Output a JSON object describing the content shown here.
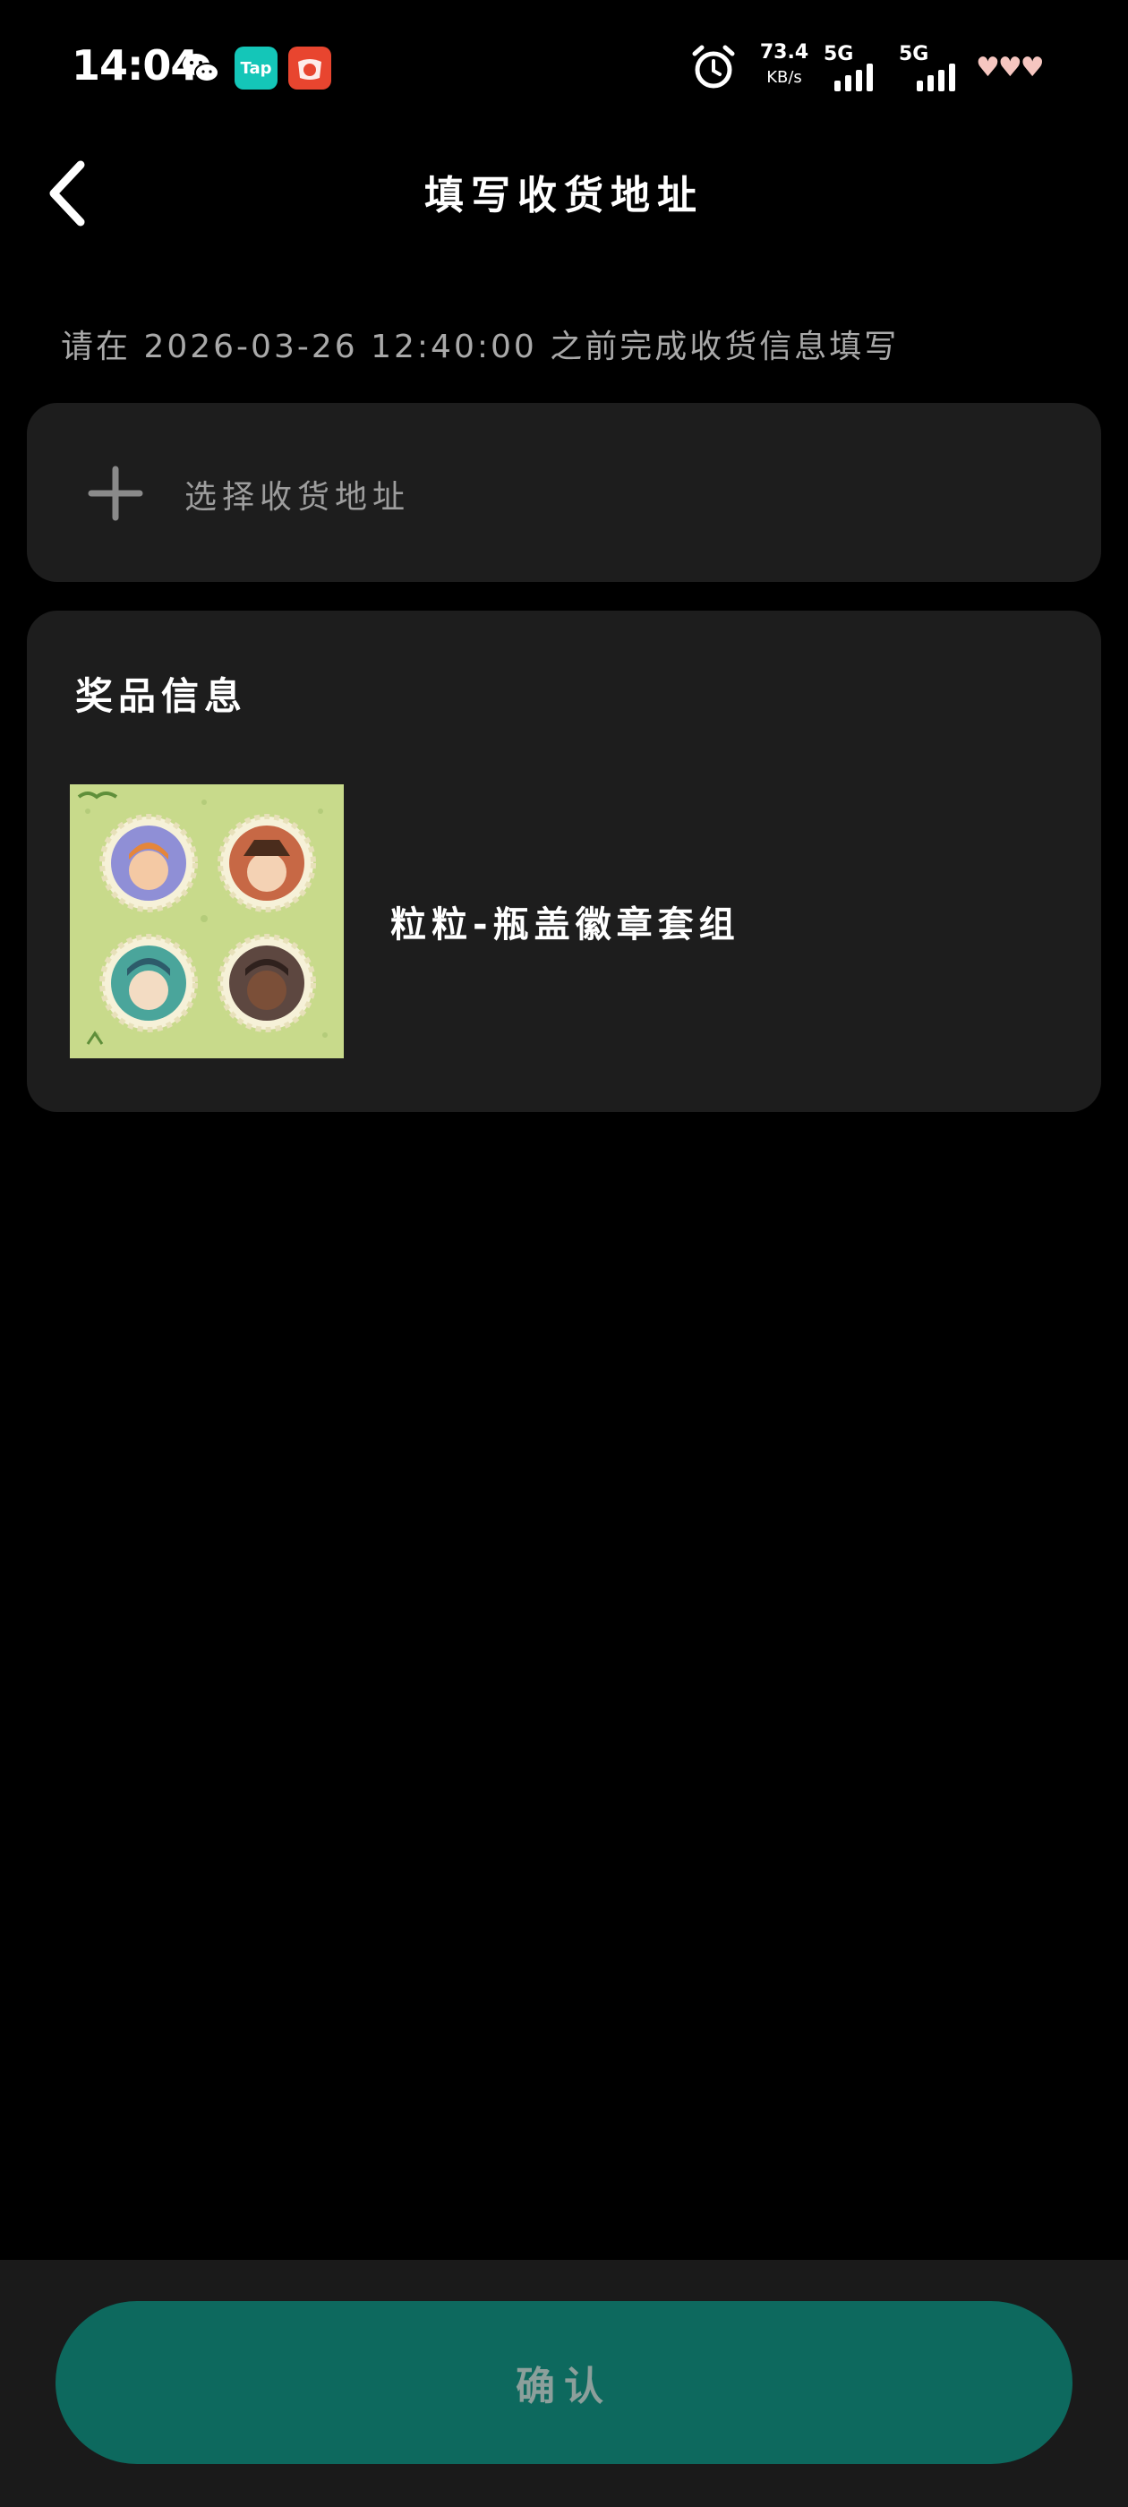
{
  "status_bar": {
    "time": "14:04",
    "apps": [
      "wechat-icon",
      "taptap-icon",
      "red-app-icon"
    ],
    "taptap_label": "Tap",
    "net_speed": "73.4",
    "net_speed_unit": "KB/s",
    "network1": "5G",
    "network2": "5G",
    "signal1_level": 4,
    "signal2_level": 4
  },
  "header": {
    "title": "填写收货地址"
  },
  "notice": "请在 2026-03-26 12:40:00 之前完成收货信息填写",
  "address": {
    "select_label": "选择收货地址"
  },
  "prize": {
    "section_title": "奖品信息",
    "name": "粒粒-瓶盖徽章套组"
  },
  "footer": {
    "confirm_label": "确认"
  },
  "colors": {
    "background": "#000000",
    "card": "#1d1d1d",
    "accent": "#0d695e",
    "muted_text": "#a9a9a9"
  }
}
